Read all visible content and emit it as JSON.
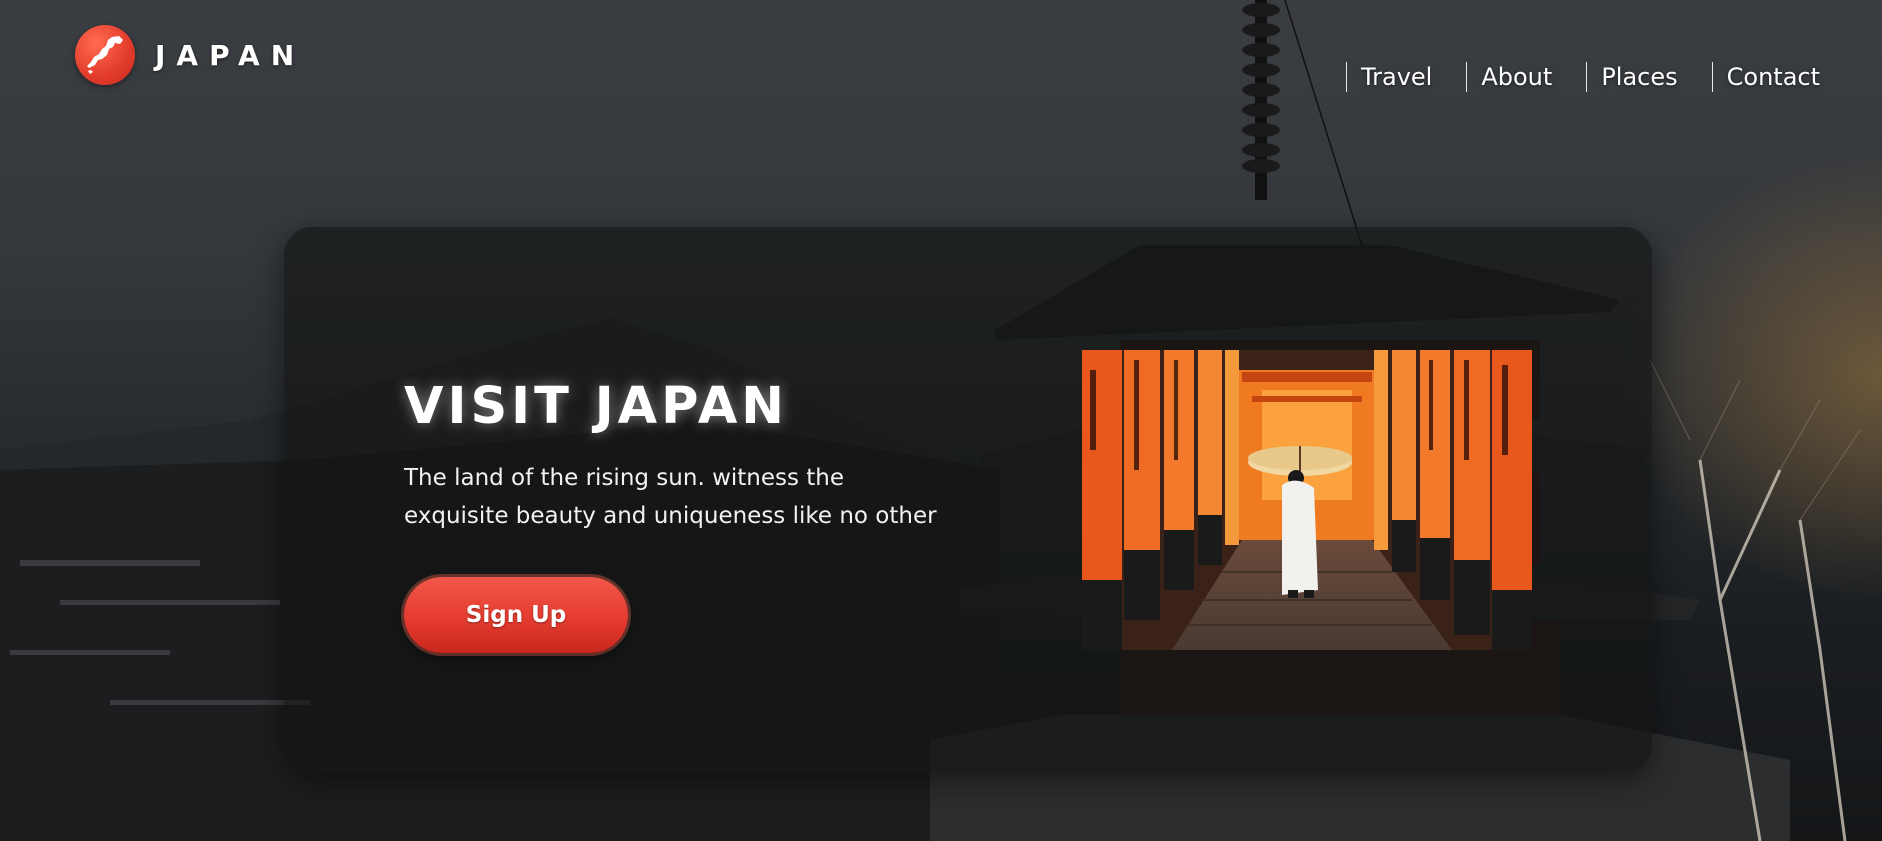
{
  "brand": {
    "name": "JAPAN",
    "icon": "japan-map-icon",
    "accent": "#e5392c"
  },
  "nav": {
    "items": [
      "Travel",
      "About",
      "Places",
      "Contact"
    ]
  },
  "hero": {
    "title": "VISIT JAPAN",
    "subtitle": "The land of the rising sun. witness the exquisite beauty and uniqueness like no other",
    "cta_label": "Sign Up",
    "image": "torii-gates-photo"
  },
  "colors": {
    "card_bg": "#121314",
    "gate_orange": "#e8581c",
    "cta_red": "#e53c30"
  }
}
